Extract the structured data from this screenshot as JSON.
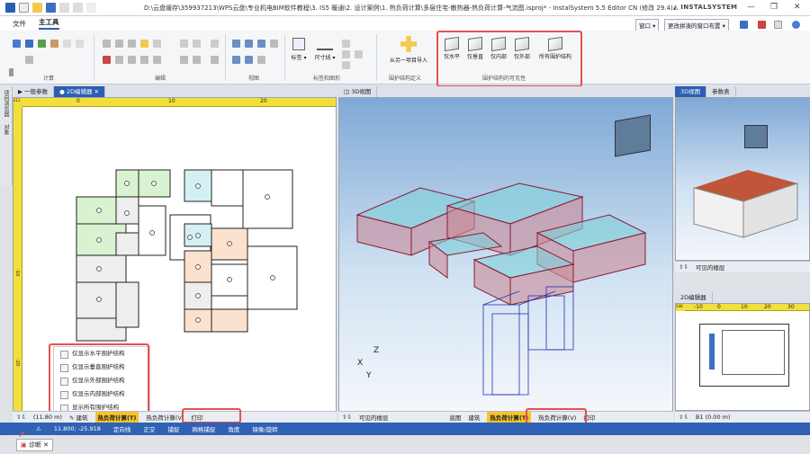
{
  "titlebar": {
    "title": "D:\\云盘缓存\\359937213\\WPS云盘\\专业机电BIM软件教程\\3. IS5 暖通\\2. 设计案例\\1. 热负荷计算\\多层住宅-散热器-热负荷计算-气流图.isproj* - InstalSystem 5.5 Editor CN (修改 29.4)",
    "brand": "INSTALSYSTEM"
  },
  "menu": {
    "file": "文件",
    "home": "主工具"
  },
  "topright": {
    "window": "窗口",
    "layout": "更改拼凑的窗口布置"
  },
  "ribbon": {
    "groups": {
      "calc": "计算",
      "edit": "编辑",
      "view": "视图",
      "annot": "标签和图形",
      "envdef": "围护结构定义",
      "visibility": "围护结构的可见性"
    },
    "label_btn": "标签",
    "dim_btn": "尺寸线",
    "import_btn": "从另一项目导入",
    "vis_buttons": [
      "仅水平",
      "仅垂直",
      "仅内部",
      "仅外部",
      "所有围护结构"
    ]
  },
  "tabs": {
    "params": "一般参数",
    "editor2d": "● 2D编辑器",
    "view3d": "3D视图",
    "view3d_small": "3D视图",
    "params_small": "参数表",
    "editor2d_small": "2D编辑器"
  },
  "rulers": {
    "h": [
      "0",
      "10",
      "20"
    ],
    "v": [
      "-10",
      "-20"
    ],
    "corner": "212",
    "small_h": [
      "-10",
      "0",
      "10",
      "20",
      "30"
    ],
    "small_corner": "548"
  },
  "context_menu": [
    "仅显示水平围护结构",
    "仅显示垂直围护结构",
    "仅显示外部围护结构",
    "仅显示内部围护结构",
    "显示所有围护结构"
  ],
  "bottom_left": {
    "level": "(11.80 m)",
    "b": "建筑",
    "hl": "热负荷计算(T)",
    "flow": "热负荷计算(V)",
    "print": "打印"
  },
  "bottom_3d": {
    "visible": "可见的楼层",
    "floor": "底图",
    "b": "建筑",
    "hl": "热负荷计算(T)",
    "flow": "热负荷计算(V)",
    "print": "打印"
  },
  "right_mid": {
    "visible": "可见的楼层"
  },
  "right_bottom": {
    "level": "B1 (0.00 m)"
  },
  "status": {
    "coords": "11.800; -25.918",
    "items": [
      "定向线",
      "正交",
      "捕捉",
      "网格捕捉",
      "角度",
      "镜像/旋转"
    ]
  },
  "diag": "诊断",
  "side": {
    "a": "项目浏览器",
    "b": "对象"
  },
  "axes": {
    "x": "X",
    "y": "Y",
    "z": "Z"
  },
  "colors": {
    "accent": "#2b5fb3",
    "highlight": "#f7c52b",
    "marker": "#e55050",
    "ruler": "#f3df3a"
  }
}
